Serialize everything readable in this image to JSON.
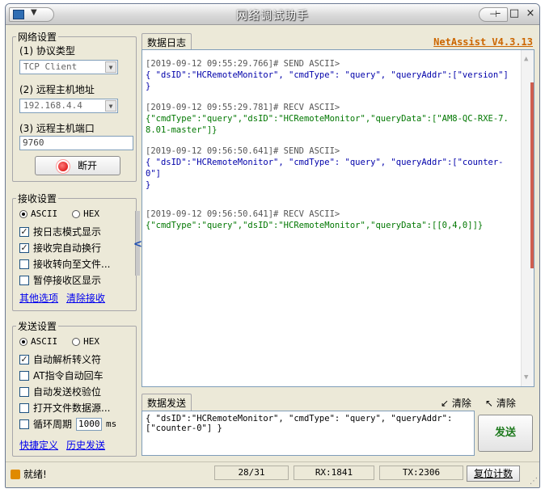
{
  "window": {
    "title": "网络调试助手",
    "pin_icon": "pin-icon",
    "minimize": "–",
    "maximize": "□",
    "close": "×"
  },
  "net": {
    "group_title": "网络设置",
    "protocol_label": "(1) 协议类型",
    "protocol_value": "TCP Client",
    "host_label": "(2) 远程主机地址",
    "host_value": "192.168.4.4",
    "port_label": "(3) 远程主机端口",
    "port_value": "9760",
    "disconnect_label": "断开"
  },
  "recv": {
    "group_title": "接收设置",
    "ascii_label": "ASCII",
    "hex_label": "HEX",
    "ascii_selected": true,
    "options": [
      {
        "label": "按日志模式显示",
        "checked": true
      },
      {
        "label": "接收完自动换行",
        "checked": true
      },
      {
        "label": "接收转向至文件...",
        "checked": false
      },
      {
        "label": "暂停接收区显示",
        "checked": false
      }
    ],
    "link_more": "其他选项",
    "link_clear": "清除接收"
  },
  "send_settings": {
    "group_title": "发送设置",
    "ascii_label": "ASCII",
    "hex_label": "HEX",
    "options": [
      {
        "label": "自动解析转义符",
        "checked": true
      },
      {
        "label": "AT指令自动回车",
        "checked": false
      },
      {
        "label": "自动发送校验位",
        "checked": false
      },
      {
        "label": "打开文件数据源...",
        "checked": false
      },
      {
        "label": "循环周期",
        "checked": false
      }
    ],
    "period_value": "1000",
    "period_unit": "ms",
    "link_shortcut": "快捷定义",
    "link_history": "历史发送"
  },
  "log": {
    "tab_label": "数据日志",
    "version": "NetAssist V4.3.13",
    "entries": [
      {
        "ts": "[2019-09-12 09:55:29.766]# SEND ASCII>",
        "msg": "{ \"dsID\":\"HCRemoteMonitor\", \"cmdType\": \"query\", \"queryAddr\":[\"version\"] }",
        "type": "send"
      },
      {
        "ts": "[2019-09-12 09:55:29.781]# RECV ASCII>",
        "msg": "{\"cmdType\":\"query\",\"dsID\":\"HCRemoteMonitor\",\"queryData\":[\"AM8-QC-RXE-7.8.01-master\"]}",
        "type": "recv"
      },
      {
        "ts": "[2019-09-12 09:56:50.641]# SEND ASCII>",
        "msg": "{ \"dsID\":\"HCRemoteMonitor\", \"cmdType\": \"query\", \"queryAddr\":[\"counter-0\"]\n}",
        "type": "send"
      },
      {
        "ts": "[2019-09-12 09:56:50.641]# RECV ASCII>",
        "msg": "{\"cmdType\":\"query\",\"dsID\":\"HCRemoteMonitor\",\"queryData\":[[0,4,0]]}",
        "type": "recv"
      }
    ]
  },
  "send": {
    "tab_label": "数据发送",
    "clear_label": "清除",
    "clear2_label": "清除",
    "text": "{ \"dsID\":\"HCRemoteMonitor\", \"cmdType\": \"query\", \"queryAddr\":\n[\"counter-0\"] }",
    "send_button": "发送"
  },
  "status": {
    "ready": "就绪!",
    "count": "28/31",
    "rx": "RX:1841",
    "tx": "TX:2306",
    "reset": "复位计数"
  }
}
